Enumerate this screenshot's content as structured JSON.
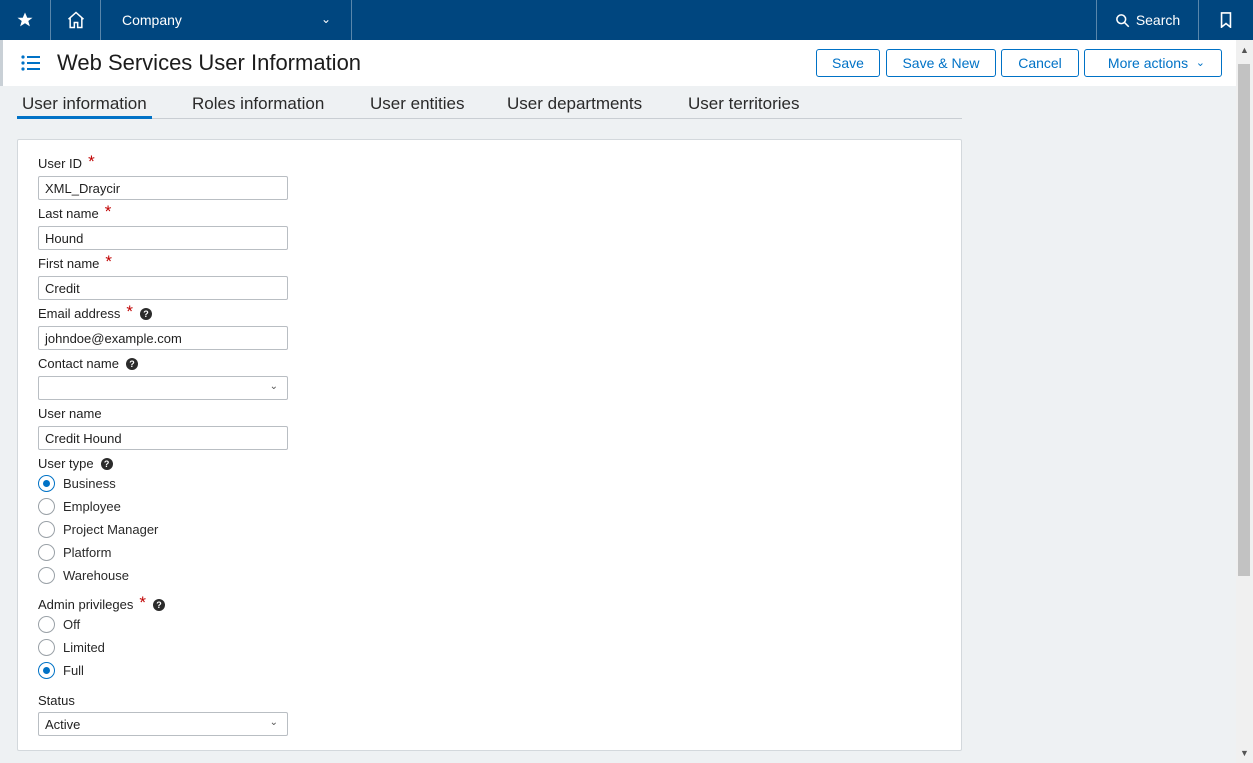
{
  "topbar": {
    "favorites_icon": "star-icon",
    "home_icon": "home-icon",
    "company_label": "Company",
    "search_label": "Search",
    "bookmark_icon": "bookmark-icon"
  },
  "header": {
    "title": "Web Services User Information",
    "buttons": {
      "save": "Save",
      "save_new": "Save & New",
      "cancel": "Cancel",
      "more_actions": "More actions"
    }
  },
  "tabs": [
    {
      "label": "User information",
      "active": true
    },
    {
      "label": "Roles information",
      "active": false
    },
    {
      "label": "User entities",
      "active": false
    },
    {
      "label": "User departments",
      "active": false
    },
    {
      "label": "User territories",
      "active": false
    }
  ],
  "form": {
    "user_id": {
      "label": "User ID",
      "value": "XML_Draycir",
      "required": true
    },
    "last_name": {
      "label": "Last name",
      "value": "Hound",
      "required": true
    },
    "first_name": {
      "label": "First name",
      "value": "Credit",
      "required": true
    },
    "email": {
      "label": "Email address",
      "value": "johndoe@example.com",
      "required": true
    },
    "contact_name": {
      "label": "Contact name",
      "value": ""
    },
    "user_name": {
      "label": "User name",
      "value": "Credit Hound"
    },
    "user_type": {
      "label": "User type",
      "options": [
        "Business",
        "Employee",
        "Project Manager",
        "Platform",
        "Warehouse"
      ],
      "selected": "Business"
    },
    "admin_privileges": {
      "label": "Admin privileges",
      "options": [
        "Off",
        "Limited",
        "Full"
      ],
      "selected": "Full",
      "required": true
    },
    "status": {
      "label": "Status",
      "value": "Active"
    }
  },
  "colors": {
    "topbar": "#00467f",
    "accent": "#0072c6",
    "required": "#c00000"
  }
}
